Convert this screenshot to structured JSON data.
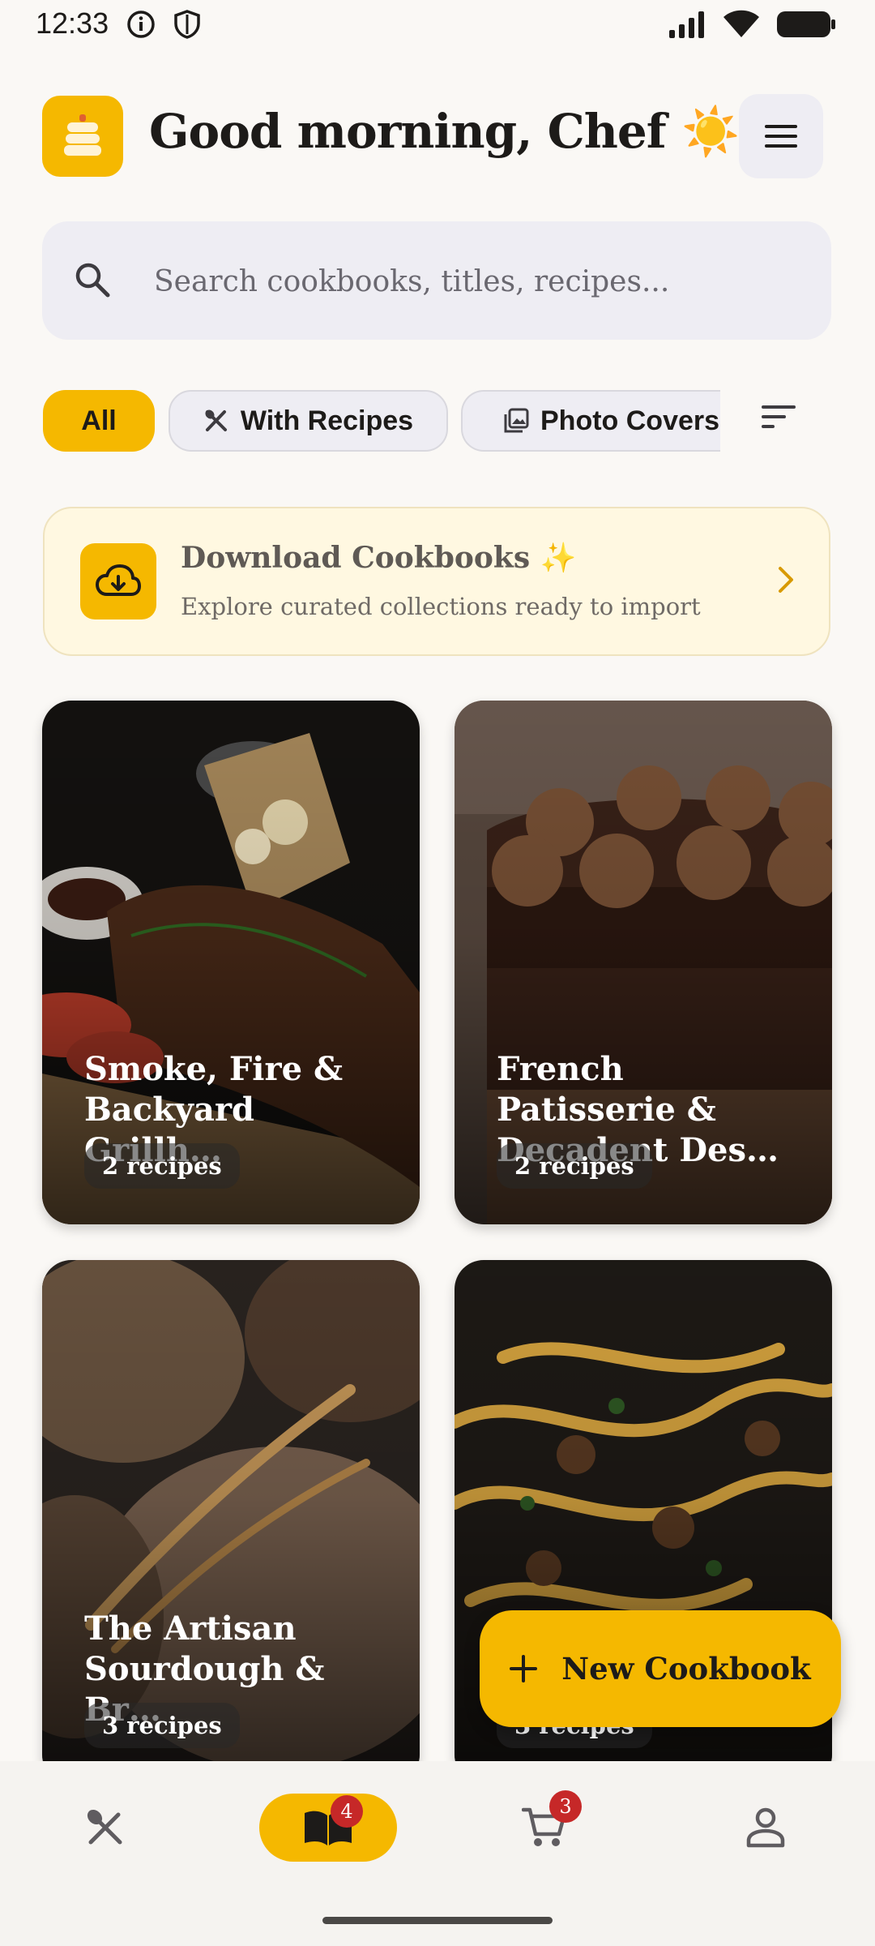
{
  "status_bar": {
    "time": "12:33"
  },
  "header": {
    "greeting": "Good morning, Chef ☀️"
  },
  "search": {
    "placeholder": "Search cookbooks, titles, recipes..."
  },
  "filters": [
    {
      "label": "All",
      "active": true
    },
    {
      "label": "With Recipes",
      "active": false
    },
    {
      "label": "Photo Covers",
      "active": false
    }
  ],
  "banner": {
    "title": "Download Cookbooks ✨",
    "subtitle": "Explore curated collections ready to import"
  },
  "cookbooks": [
    {
      "title": "Smoke, Fire & Backyard Grillh…",
      "count": "2 recipes"
    },
    {
      "title": "French Patisserie & Decadent Des…",
      "count": "2 recipes"
    },
    {
      "title": "The Artisan Sourdough & Br…",
      "count": "3 recipes"
    },
    {
      "title": "",
      "count": "3 recipes"
    }
  ],
  "fab": {
    "label": "New Cookbook"
  },
  "bottom_nav": {
    "cookbooks_badge": "4",
    "cart_badge": "3"
  },
  "colors": {
    "accent": "#f5b800",
    "badge": "#c62828",
    "background": "#faf8f5"
  }
}
